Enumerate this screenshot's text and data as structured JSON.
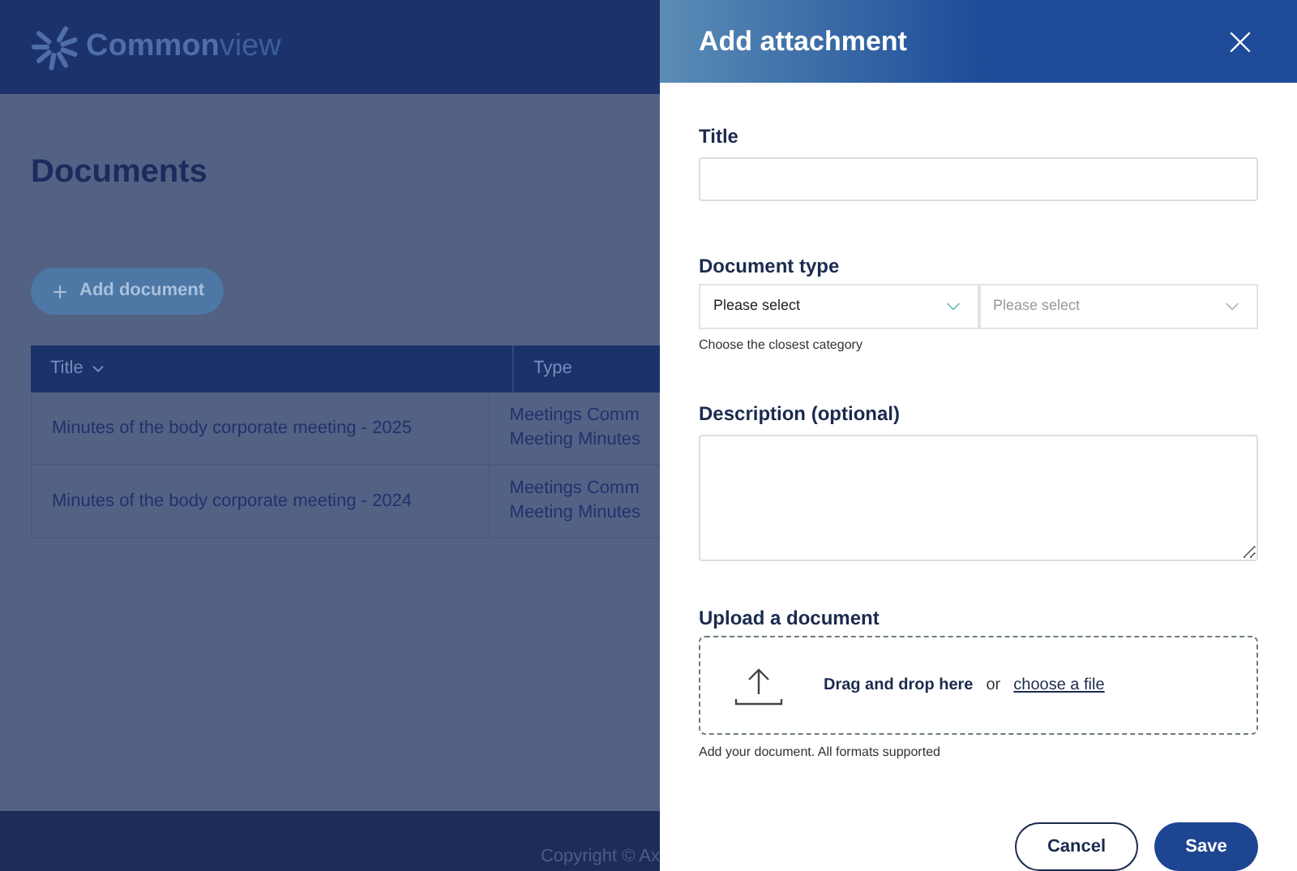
{
  "header": {
    "brand_strong": "Common",
    "brand_light": "view"
  },
  "page": {
    "heading": "Documents",
    "add_button": "Add document"
  },
  "table": {
    "columns": [
      {
        "label": "Title",
        "sortable": true
      },
      {
        "label": "Type",
        "sortable": false
      }
    ],
    "rows": [
      {
        "title": "Minutes of the body corporate meeting - 2025",
        "type": [
          "Meetings Comm",
          "Meeting Minutes"
        ]
      },
      {
        "title": "Minutes of the body corporate meeting - 2024",
        "type": [
          "Meetings Comm",
          "Meeting Minutes"
        ]
      }
    ]
  },
  "footer": {
    "text": "Copyright © Ax"
  },
  "panel": {
    "title": "Add attachment",
    "title_field": {
      "label": "Title"
    },
    "document_type": {
      "label": "Document type",
      "selects": [
        {
          "placeholder": "Please select",
          "disabled": false
        },
        {
          "placeholder": "Please select",
          "disabled": true
        }
      ],
      "hint": "Choose the closest category"
    },
    "description": {
      "label": "Description (optional)"
    },
    "upload": {
      "label": "Upload a document",
      "drag_text": "Drag and drop here",
      "or_text": "or",
      "link": "choose a file",
      "hint": "Add your document. All formats supported"
    },
    "buttons": [
      {
        "label": "Cancel",
        "kind": "secondary"
      },
      {
        "label": "Save",
        "kind": "primary"
      }
    ]
  }
}
